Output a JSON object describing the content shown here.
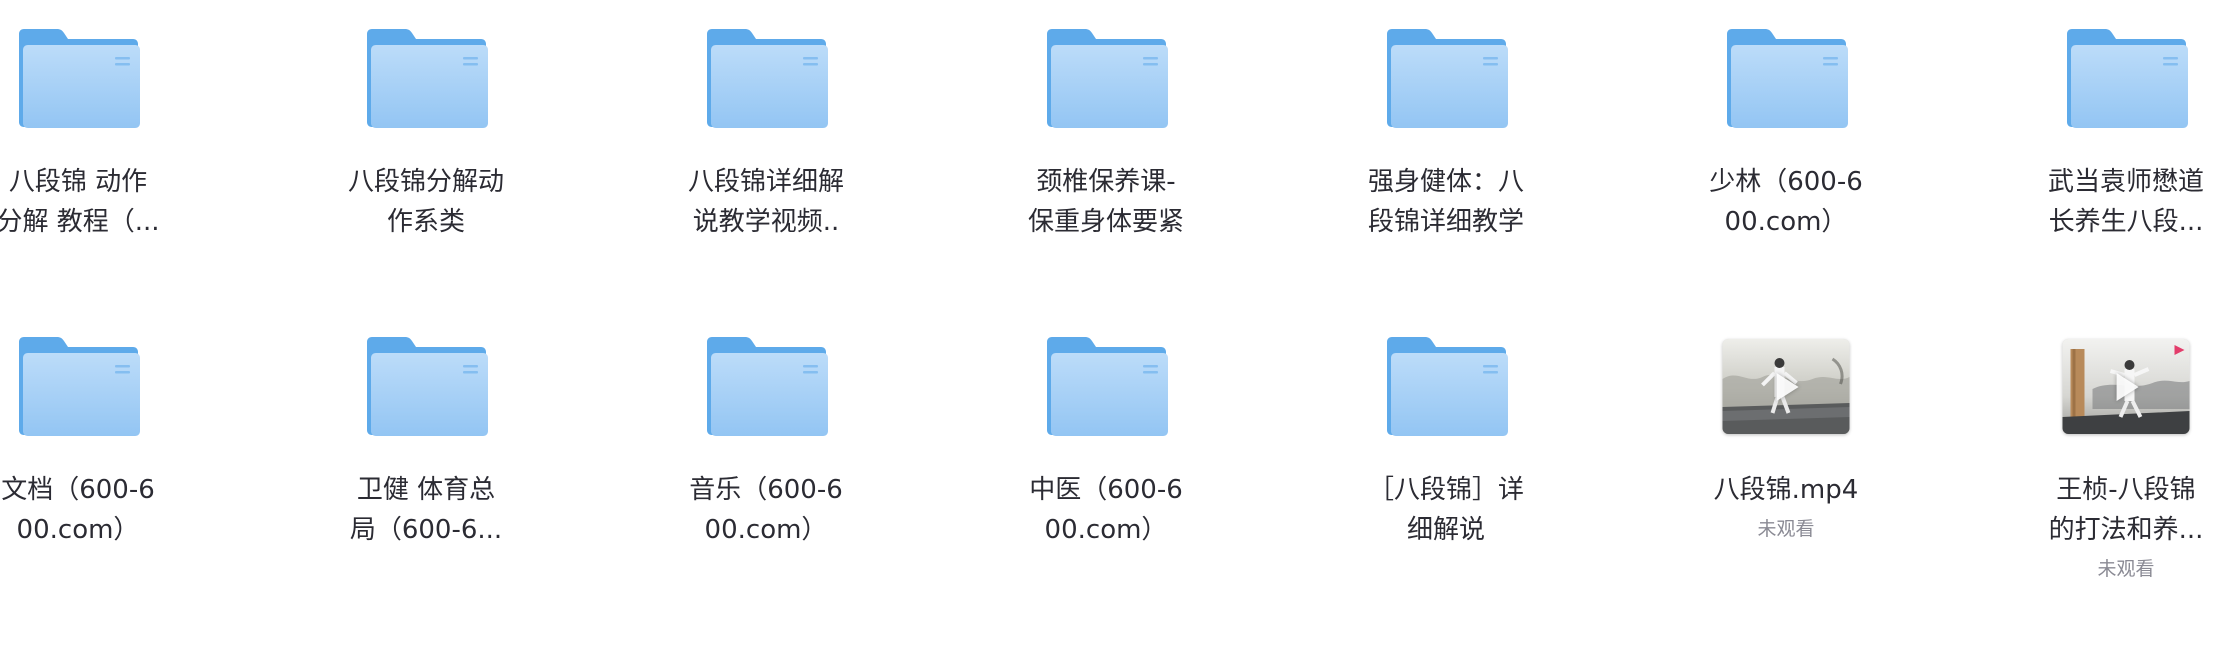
{
  "colors": {
    "folder_back": "#5eaaea",
    "folder_front_top": "#bcdcf9",
    "folder_front_bottom": "#93c5f3",
    "text": "#2b2b33",
    "subtext": "#8a8a94"
  },
  "items": [
    {
      "type": "folder",
      "icon": "folder-icon",
      "name_line1": "八段锦 动作",
      "name_line2": "分解 教程（..."
    },
    {
      "type": "folder",
      "icon": "folder-icon",
      "name_line1": "八段锦分解动",
      "name_line2": "作系类"
    },
    {
      "type": "folder",
      "icon": "folder-icon",
      "name_line1": "八段锦详细解",
      "name_line2": "说教学视频.."
    },
    {
      "type": "folder",
      "icon": "folder-icon",
      "name_line1": "颈椎保养课-",
      "name_line2": "保重身体要紧"
    },
    {
      "type": "folder",
      "icon": "folder-icon",
      "name_line1": "强身健体：八",
      "name_line2": "段锦详细教学"
    },
    {
      "type": "folder",
      "icon": "folder-icon",
      "name_line1": "少林（600-6",
      "name_line2": "00.com）"
    },
    {
      "type": "folder",
      "icon": "folder-icon",
      "name_line1": "武当袁师懋道",
      "name_line2": "长养生八段..."
    },
    {
      "type": "folder",
      "icon": "folder-icon",
      "name_line1": "文档（600-6",
      "name_line2": "00.com）"
    },
    {
      "type": "folder",
      "icon": "folder-icon",
      "name_line1": "卫健 体育总",
      "name_line2": "局（600-6..."
    },
    {
      "type": "folder",
      "icon": "folder-icon",
      "name_line1": "音乐（600-6",
      "name_line2": "00.com）"
    },
    {
      "type": "folder",
      "icon": "folder-icon",
      "name_line1": "中医（600-6",
      "name_line2": "00.com）"
    },
    {
      "type": "folder",
      "icon": "folder-icon",
      "name_line1": "［八段锦］详",
      "name_line2": "细解说"
    },
    {
      "type": "video",
      "icon": "play-icon",
      "name_line1": "八段锦.mp4",
      "name_line2": "",
      "status": "未观看"
    },
    {
      "type": "video",
      "icon": "play-icon",
      "name_line1": "王桢-八段锦",
      "name_line2": "的打法和养...",
      "status": "未观看"
    }
  ]
}
